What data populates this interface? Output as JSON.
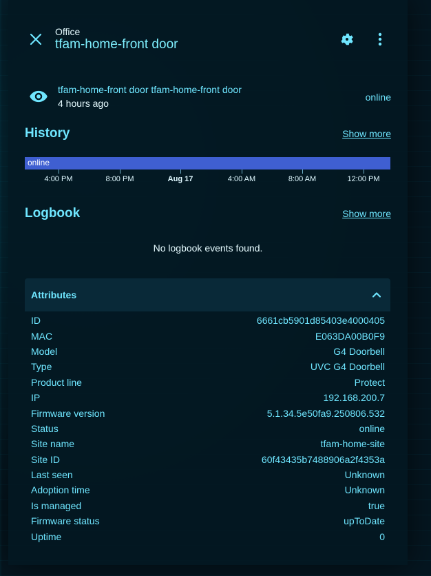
{
  "header": {
    "area": "Office",
    "title": "tfam-home-front door"
  },
  "state": {
    "name": "tfam-home-front door tfam-home-front door",
    "time": "4 hours ago",
    "value": "online"
  },
  "history": {
    "title": "History",
    "show_more": "Show more",
    "bar_label": "online",
    "ticks": [
      "4:00 PM",
      "8:00 PM",
      "Aug 17",
      "4:00 AM",
      "8:00 AM",
      "12:00 PM"
    ]
  },
  "logbook": {
    "title": "Logbook",
    "show_more": "Show more",
    "empty": "No logbook events found."
  },
  "attributes": {
    "title": "Attributes",
    "rows": [
      {
        "key": "ID",
        "value": "6661cb5901d85403e4000405"
      },
      {
        "key": "MAC",
        "value": "E063DA00B0F9"
      },
      {
        "key": "Model",
        "value": "G4 Doorbell"
      },
      {
        "key": "Type",
        "value": "UVC G4 Doorbell"
      },
      {
        "key": "Product line",
        "value": "Protect"
      },
      {
        "key": "IP",
        "value": "192.168.200.7"
      },
      {
        "key": "Firmware version",
        "value": "5.1.34.5e50fa9.250806.532"
      },
      {
        "key": "Status",
        "value": "online"
      },
      {
        "key": "Site name",
        "value": "tfam-home-site"
      },
      {
        "key": "Site ID",
        "value": "60f43435b7488906a2f4353a"
      },
      {
        "key": "Last seen",
        "value": "Unknown"
      },
      {
        "key": "Adoption time",
        "value": "Unknown"
      },
      {
        "key": "Is managed",
        "value": "true"
      },
      {
        "key": "Firmware status",
        "value": "upToDate"
      },
      {
        "key": "Uptime",
        "value": "0"
      }
    ]
  },
  "colors": {
    "accent": "#6fe6ff",
    "timeline_bar": "#3f5fd1",
    "surface": "#03181f"
  }
}
